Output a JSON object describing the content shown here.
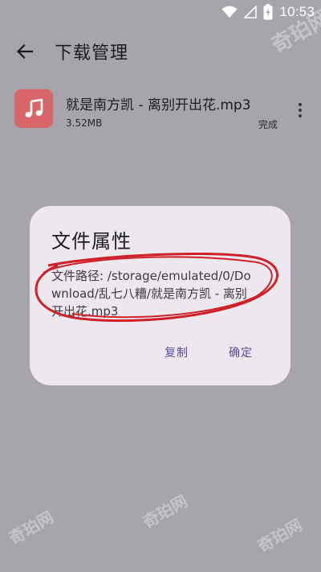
{
  "status_bar": {
    "time": "10:53",
    "icons": [
      "wifi-icon",
      "signal-icon",
      "battery-charging-icon"
    ]
  },
  "header": {
    "title": "下载管理",
    "back_icon": "arrow-left-icon"
  },
  "download_item": {
    "icon": "music-note-icon",
    "icon_color": "#d86669",
    "file_name": "就是南方凯 - 离别开出花.mp3",
    "file_size": "3.52MB",
    "status": "完成",
    "menu_icon": "more-vert-icon"
  },
  "dialog": {
    "title": "文件属性",
    "body": "文件路径: /storage/emulated/0/Download/乱七八糟/就是南方凯 - 离别开出花.mp3",
    "copy_label": "复制",
    "ok_label": "确定",
    "accent_color": "#5b4ba0"
  },
  "annotation": {
    "color": "#d0202a"
  },
  "watermark": {
    "text": "奇珀网"
  }
}
